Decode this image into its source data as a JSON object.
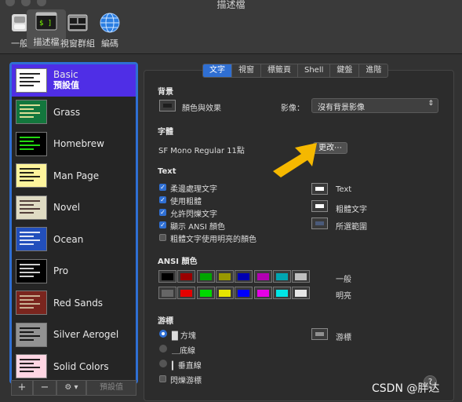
{
  "window": {
    "title": "描述檔"
  },
  "toolbar": [
    {
      "label": "一般",
      "icon": "switch-icon"
    },
    {
      "label": "描述檔",
      "icon": "terminal-icon",
      "active": true
    },
    {
      "label": "視窗群組",
      "icon": "window-group-icon"
    },
    {
      "label": "編碼",
      "icon": "globe-icon"
    }
  ],
  "profiles": [
    {
      "name": "Basic",
      "default_label": "預設值",
      "selected": true,
      "bg": "#ffffff",
      "fg": "#000000"
    },
    {
      "name": "Grass",
      "bg": "#13773d",
      "fg": "#fff0a5"
    },
    {
      "name": "Homebrew",
      "bg": "#000000",
      "fg": "#28fe14"
    },
    {
      "name": "Man Page",
      "bg": "#fef49c",
      "fg": "#000000"
    },
    {
      "name": "Novel",
      "bg": "#dfdbc3",
      "fg": "#3b2322"
    },
    {
      "name": "Ocean",
      "bg": "#224fbc",
      "fg": "#ffffff"
    },
    {
      "name": "Pro",
      "bg": "#000000",
      "fg": "#f2f2f2"
    },
    {
      "name": "Red Sands",
      "bg": "#7a251e",
      "fg": "#d7c9a7"
    },
    {
      "name": "Silver Aerogel",
      "bg": "#929292",
      "fg": "#000000"
    },
    {
      "name": "Solid Colors",
      "bg": "#ffd6e3",
      "fg": "#000000"
    }
  ],
  "bottom_bar": {
    "add": "+",
    "remove": "−",
    "gear": "⚙ ▾",
    "default": "預設值"
  },
  "tabs": [
    "文字",
    "視窗",
    "標籤頁",
    "Shell",
    "鍵盤",
    "進階"
  ],
  "background": {
    "heading": "背景",
    "color_effects": "顏色與效果",
    "image_label": "影像：",
    "image_value": "沒有背景影像"
  },
  "font": {
    "heading": "字體",
    "value": "SF Mono Regular 11點",
    "change_button": "更改⋯"
  },
  "text": {
    "heading": "Text",
    "options": [
      {
        "label": "柔邊處理文字",
        "checked": true
      },
      {
        "label": "使用粗體",
        "checked": true
      },
      {
        "label": "允許閃爍文字",
        "checked": true
      },
      {
        "label": "顯示 ANSI 顏色",
        "checked": true
      },
      {
        "label": "粗體文字使用明亮的顏色",
        "checked": false
      }
    ],
    "color_labels": [
      "Text",
      "粗體文字",
      "所選範圍"
    ],
    "colors": [
      "#ffffff",
      "#ffffff",
      "#4a5a7a"
    ]
  },
  "ansi": {
    "heading": "ANSI 顏色",
    "normal_label": "一般",
    "bright_label": "明亮",
    "normal": [
      "#000000",
      "#990000",
      "#00a600",
      "#999900",
      "#0000b2",
      "#b200b2",
      "#00a6b2",
      "#bfbfbf"
    ],
    "bright": [
      "#666666",
      "#e50000",
      "#00d900",
      "#e5e500",
      "#0000ff",
      "#e500e5",
      "#00e5e5",
      "#e5e5e5"
    ]
  },
  "cursor": {
    "heading": "游標",
    "options": [
      {
        "label": "█ 方塊",
        "selected": true
      },
      {
        "label": "＿底線",
        "selected": false
      },
      {
        "label": "▎垂直線",
        "selected": false
      }
    ],
    "cursor_label": "游標",
    "cursor_color": "#909090",
    "blink_label": "閃爍游標",
    "blink_checked": false
  },
  "help": "?",
  "watermark": "CSDN @胖达"
}
